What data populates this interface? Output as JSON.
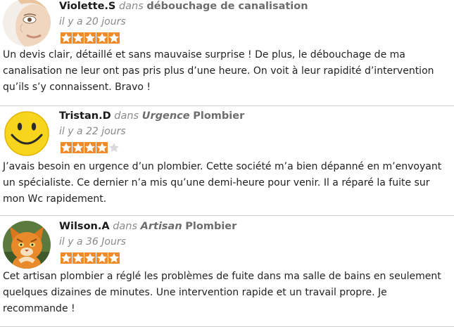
{
  "reviews": [
    {
      "author": "Violette.S",
      "in_label": "dans",
      "category_em": "",
      "category": "débouchage de canalisation",
      "date": "il y a 20 jours",
      "rating": 5,
      "avatar_icon": "woman-face-avatar",
      "text": "Un devis clair, détaillé et sans mauvaise surprise ! De plus, le débouchage de ma canalisation ne leur ont pas pris plus d’une heure. On voit à leur rapidité d’intervention qu’ils s’y connaissent. Bravo !"
    },
    {
      "author": "Tristan.D",
      "in_label": "dans",
      "category_em": "Urgence",
      "category": "Plombier",
      "date": "il y a 22 jours",
      "rating": 4,
      "avatar_icon": "smiley-avatar",
      "text": "J’avais besoin en urgence d’un plombier. Cette société m’a bien dépanné en m’envoyant un spécialiste. Ce dernier n’a mis qu’une demi-heure pour venir. Il a réparé la fuite sur mon Wc rapidement."
    },
    {
      "author": "Wilson.A",
      "in_label": "dans",
      "category_em": "Artisan",
      "category": "Plombier",
      "date": "il y a 36 Jours",
      "rating": 5,
      "avatar_icon": "cat-avatar",
      "text": "Cet artisan plombier a réglé les problèmes de fuite dans ma salle de bains en seulement quelques dizaines de minutes. Une intervention rapide et un travail propre. Je recommande !"
    }
  ],
  "colors": {
    "star_on": "#ef8a2b",
    "star_off": "#d9d9d9",
    "divider": "#cfcfcf"
  }
}
